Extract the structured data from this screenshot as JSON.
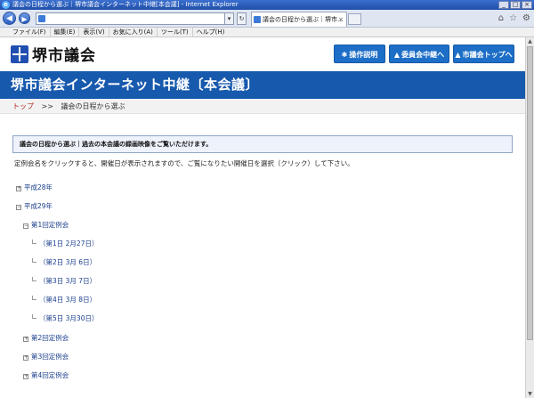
{
  "browser": {
    "title": "議会の日程から選ぶ｜堺市議会インターネット中継[本会議] - Internet Explorer",
    "tab_label": "議会の日程から選ぶ｜堺市...",
    "menu": [
      "ファイル(F)",
      "編集(E)",
      "表示(V)",
      "お気に入り(A)",
      "ツール(T)",
      "ヘルプ(H)"
    ]
  },
  "site": {
    "logo_text": "堺市議会",
    "buttons": {
      "manual": "操作説明",
      "committee": "委員会中継へ",
      "top": "市議会トップへ"
    },
    "banner_title": "堺市議会インターネット中継〔本会議〕"
  },
  "breadcrumb": {
    "home": "トップ",
    "separator": ">>",
    "current": "議会の日程から選ぶ"
  },
  "main": {
    "notice": "議会の日程から選ぶ｜過去の本会議の録画映像をご覧いただけます。",
    "description": "定例会名をクリックすると、開催日が表示されますので、ご覧になりたい開催日を選択（クリック）して下さい。",
    "tree": {
      "year_2016": "平成28年",
      "year_2017": "平成29年",
      "session_1": "第1回定例会",
      "days": [
        "（第1日 2月27日）",
        "（第2日 3月 6日）",
        "（第3日 3月 7日）",
        "（第4日 3月 8日）",
        "（第5日 3月30日）"
      ],
      "session_2": "第2回定例会",
      "session_3": "第3回定例会",
      "session_4": "第4回定例会"
    }
  },
  "colors": {
    "banner": "#1759ad",
    "button": "#1d6ec7",
    "link": "#1a3e8c",
    "breadcrumb_home": "#b3261e"
  }
}
